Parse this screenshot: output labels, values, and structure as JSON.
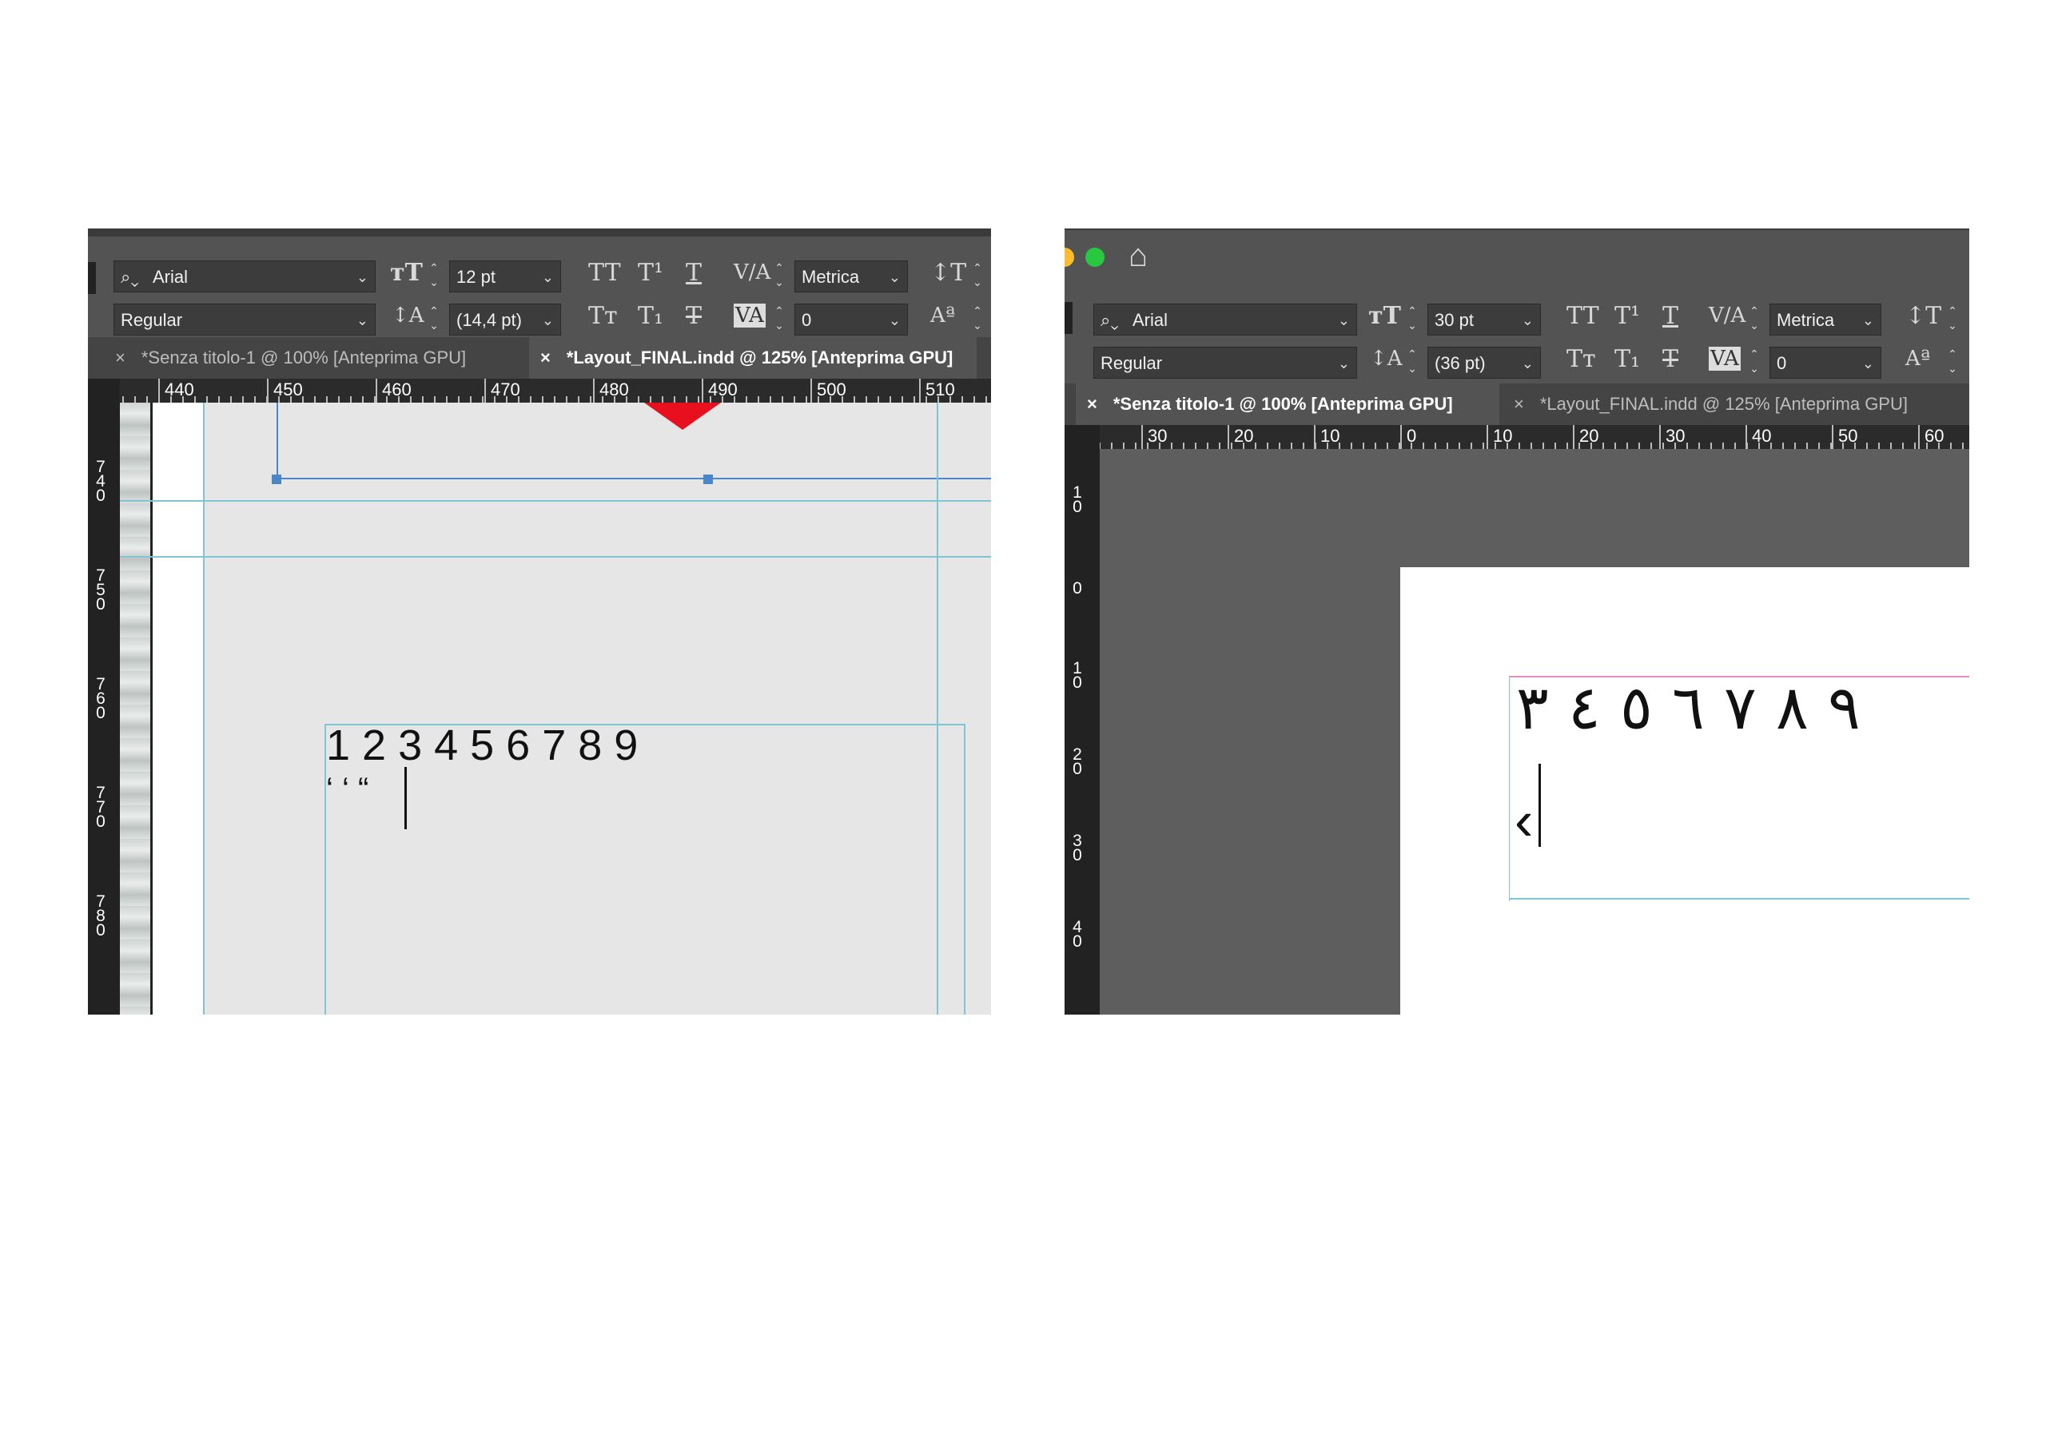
{
  "left": {
    "toolbar": {
      "font_family": "Arial",
      "font_style": "Regular",
      "font_size": "12 pt",
      "leading": "(14,4 pt)",
      "kerning": "Metrica",
      "tracking": "0"
    },
    "tabs": [
      {
        "close": "×",
        "label": "*Senza titolo-1 @ 100% [Anteprima GPU]",
        "active": false
      },
      {
        "close": "×",
        "label": "*Layout_FINAL.indd @ 125% [Anteprima GPU]",
        "active": true
      }
    ],
    "ruler_h": [
      "440",
      "450",
      "460",
      "470",
      "480",
      "490",
      "500",
      "510"
    ],
    "ruler_v": [
      "740",
      "750",
      "760",
      "770",
      "780"
    ],
    "text_line1": "1 2 3 4 5 6 7 8 9",
    "text_line2": "‘ ‘ “"
  },
  "right": {
    "toolbar": {
      "font_family": "Arial",
      "font_style": "Regular",
      "font_size": "30 pt",
      "leading": "(36 pt)",
      "kerning": "Metrica",
      "tracking": "0"
    },
    "tabs": [
      {
        "close": "×",
        "label": "*Senza titolo-1 @ 100% [Anteprima GPU]",
        "active": true
      },
      {
        "close": "×",
        "label": "*Layout_FINAL.indd @ 125% [Anteprima GPU]",
        "active": false
      }
    ],
    "ruler_h": [
      "30",
      "20",
      "10",
      "0",
      "10",
      "20",
      "30",
      "40",
      "50",
      "60"
    ],
    "ruler_v": [
      "10",
      "0",
      "10",
      "20",
      "30",
      "40"
    ],
    "arabic_line1": "٩ ٨ ٧ ٦ ٥ ٤ ٣",
    "arabic_line2": "‹"
  },
  "icons": {
    "search": "search-icon",
    "home": "home-icon",
    "font_size": "font-size-icon",
    "leading": "leading-icon",
    "all_caps": "all-caps-icon",
    "superscript": "superscript-icon",
    "underline": "underline-icon",
    "small_caps": "small-caps-icon",
    "subscript": "subscript-icon",
    "strikethrough": "strikethrough-icon",
    "kerning": "kerning-icon",
    "tracking": "tracking-icon",
    "vertical_scale": "vertical-scale-icon",
    "baseline_shift": "baseline-shift-icon"
  },
  "colors": {
    "app_bg": "#535353",
    "field_bg": "#3c3c3c",
    "guide": "#7ec6d4",
    "frame": "#4a86c8",
    "close_red": "#ff5f57",
    "minimize_yellow": "#febc2e",
    "maximize_green": "#28c840"
  }
}
